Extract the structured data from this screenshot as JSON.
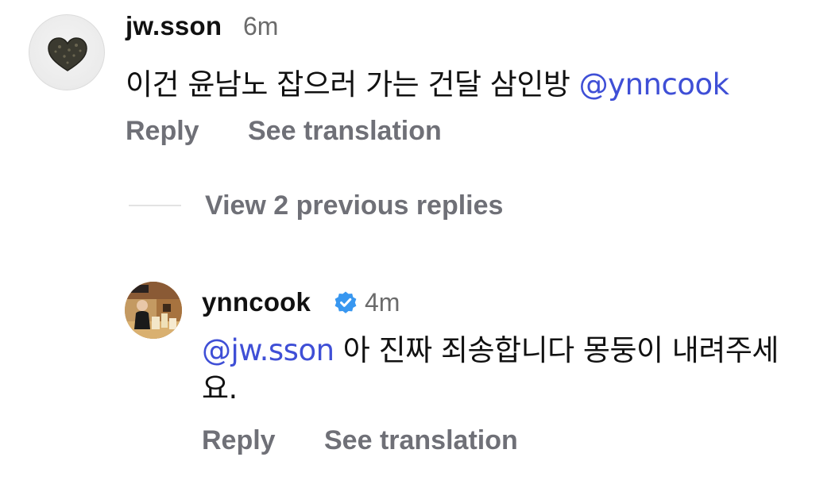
{
  "comment": {
    "username": "jw.sson",
    "time": "6m",
    "text": "이건 윤남노 잡으러 가는 건달 삼인방",
    "mention": "@ynncook",
    "reply_label": "Reply",
    "translate_label": "See translation",
    "avatar_icon": "heart-icon"
  },
  "thread": {
    "view_replies_label": "View 2 previous replies"
  },
  "reply": {
    "username": "ynncook",
    "verified_icon": "verified-badge-icon",
    "time": "4m",
    "mention": "@jw.sson",
    "text": " 아 진짜 죄송합니다 몽둥이 내려주세요.",
    "reply_label": "Reply",
    "translate_label": "See translation"
  },
  "colors": {
    "mention": "#3f4fd6",
    "action_text": "#6f7077",
    "timestamp": "#6b6b6b",
    "verified_badge": "#3897f0"
  }
}
